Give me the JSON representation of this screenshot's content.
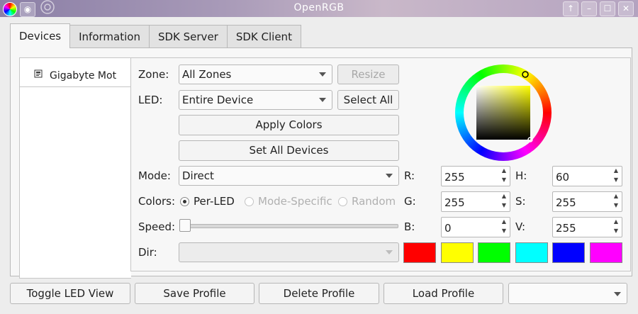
{
  "window": {
    "title": "OpenRGB"
  },
  "tabs": [
    {
      "label": "Devices"
    },
    {
      "label": "Information"
    },
    {
      "label": "SDK Server"
    },
    {
      "label": "SDK Client"
    }
  ],
  "device_list": [
    {
      "name": "Gigabyte Mot"
    }
  ],
  "controls": {
    "zone_label": "Zone:",
    "zone_value": "All Zones",
    "resize_label": "Resize",
    "led_label": "LED:",
    "led_value": "Entire Device",
    "select_all_label": "Select All",
    "apply_colors_label": "Apply Colors",
    "set_all_devices_label": "Set All Devices",
    "mode_label": "Mode:",
    "mode_value": "Direct",
    "colors_label": "Colors:",
    "color_modes": [
      {
        "label": "Per-LED",
        "selected": true,
        "enabled": true
      },
      {
        "label": "Mode-Specific",
        "selected": false,
        "enabled": false
      },
      {
        "label": "Random",
        "selected": false,
        "enabled": false
      }
    ],
    "speed_label": "Speed:",
    "speed_value": 0,
    "dir_label": "Dir:"
  },
  "color": {
    "r_label": "R:",
    "r": "255",
    "g_label": "G:",
    "g": "255",
    "b_label": "B:",
    "b": "0",
    "h_label": "H:",
    "h": "60",
    "s_label": "S:",
    "s": "255",
    "v_label": "V:",
    "v": "255",
    "current_hex": "#ffff00"
  },
  "swatches": [
    "#ff0000",
    "#ffff00",
    "#00ff00",
    "#00ffff",
    "#0000ff",
    "#ff00ff"
  ],
  "bottom": {
    "toggle_led_view": "Toggle LED View",
    "save_profile": "Save Profile",
    "delete_profile": "Delete Profile",
    "load_profile": "Load Profile"
  }
}
